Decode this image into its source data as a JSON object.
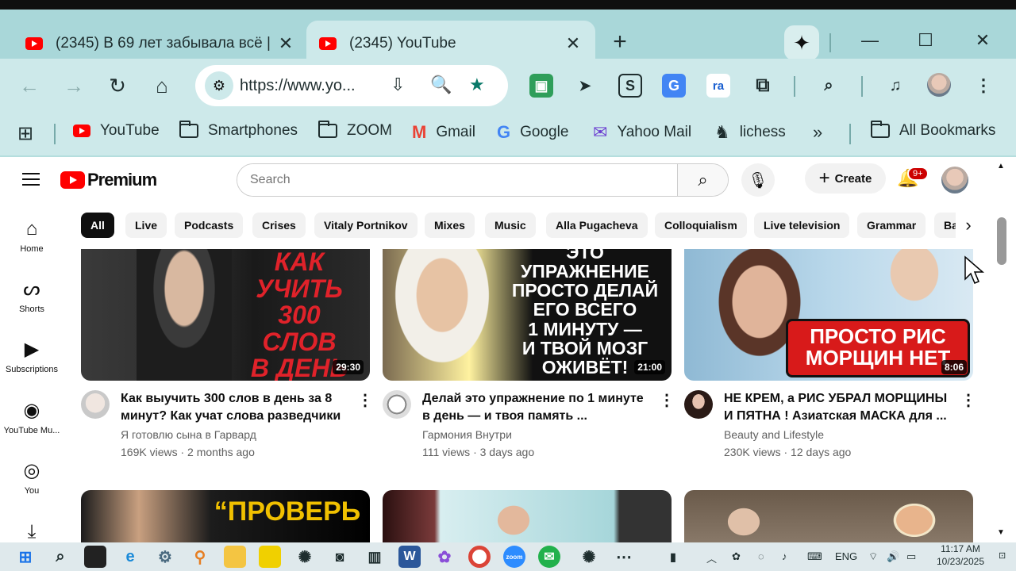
{
  "browser": {
    "tabs": [
      {
        "title": "(2345) В 69 лет забывала всё |",
        "active": false
      },
      {
        "title": "(2345) YouTube",
        "active": true
      }
    ],
    "url": "https://www.yo...",
    "bookmarks": [
      {
        "label": "YouTube",
        "icon": "youtube-icon"
      },
      {
        "label": "Smartphones",
        "icon": "folder-icon"
      },
      {
        "label": "ZOOM",
        "icon": "folder-icon"
      },
      {
        "label": "Gmail",
        "icon": "gmail-icon"
      },
      {
        "label": "Google",
        "icon": "google-icon"
      },
      {
        "label": "Yahoo Mail",
        "icon": "mail-icon"
      },
      {
        "label": "lichess",
        "icon": "lichess-icon"
      }
    ],
    "all_bookmarks": "All Bookmarks",
    "extensions": {
      "ra": "ra",
      "s": "S"
    }
  },
  "youtube": {
    "logo_text": "Premium",
    "search_placeholder": "Search",
    "create_label": "Create",
    "notif_count": "9+",
    "guide": [
      {
        "label": "Home",
        "icon": "home-icon"
      },
      {
        "label": "Shorts",
        "icon": "shorts-icon"
      },
      {
        "label": "Subscriptions",
        "icon": "subscriptions-icon"
      },
      {
        "label": "YouTube Mu...",
        "icon": "youtube-music-icon"
      },
      {
        "label": "You",
        "icon": "you-icon"
      }
    ],
    "chips": [
      "All",
      "Live",
      "Podcasts",
      "Crises",
      "Vitaly Portnikov",
      "Mixes",
      "Music",
      "Alla Pugacheva",
      "Colloquialism",
      "Live television",
      "Grammar",
      "Ba"
    ],
    "videos": [
      {
        "thumb_text": "КАК УЧИТЬ\n300 СЛОВ\nВ ДЕНЬ",
        "duration": "29:30",
        "title": "Как выучить 300 слов в день за 8 минут? Как учат слова разведчики ...",
        "channel": "Я готовлю сына в Гарвард",
        "stats": "169K views · 2 months ago"
      },
      {
        "thumb_text": "ЭТО УПРАЖНЕНИЕ\nПРОСТО ДЕЛАЙ\nЕГО ВСЕГО\n1 МИНУТУ —\nИ ТВОЙ МОЗГ\nОЖИВЁТ!",
        "duration": "21:00",
        "title": "Делай это упражнение по 1 минуте в день — и твоя память ...",
        "channel": "Гармония Внутри",
        "stats": "111 views · 3 days ago"
      },
      {
        "thumb_text": "ПРОСТО РИС\nМОРЩИН НЕТ",
        "duration": "8:06",
        "title": "НЕ КРЕМ, а РИС УБРАЛ МОРЩИНЫ И ПЯТНА ! Азиатская МАСКА для ...",
        "channel": "Beauty and Lifestyle",
        "stats": "230K views · 12 days ago"
      }
    ],
    "row2_thumb_text": "“ПРОВЕРЬ"
  },
  "taskbar": {
    "lang": "ENG",
    "time": "11:17 AM",
    "date": "10/23/2025"
  },
  "colors": {
    "accent": "#ff0000",
    "browser_frame": "#a9d7d9",
    "toolbar": "#cde9ea"
  }
}
